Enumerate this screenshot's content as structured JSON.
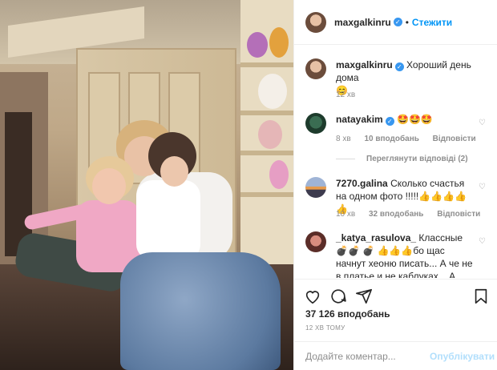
{
  "header": {
    "username": "maxgalkinru",
    "separator": "•",
    "follow_label": "Стежити"
  },
  "caption": {
    "username": "maxgalkinru",
    "text": "Хороший день дома",
    "emoji": "😊",
    "time": "12 хв"
  },
  "comments": [
    {
      "username": "natayakim",
      "verified": true,
      "text": "🤩🤩🤩",
      "time": "8 хв",
      "likes": "10 вподобань",
      "reply": "Відповісти",
      "view_replies": "Переглянути відповіді (2)"
    },
    {
      "username": "7270.galina",
      "verified": false,
      "text": "Сколько счастья на одном фото !!!!!👍👍👍👍👍",
      "time": "10 хв",
      "likes": "32 вподобань",
      "reply": "Відповісти"
    },
    {
      "username": "_katya_rasulova_",
      "verified": false,
      "text": "Классные 💣💣 💣 👍👍👍бо щас начнут хеоню писать... А че не в платье и не каблуках... А сами сидят по"
    }
  ],
  "post": {
    "likes_count": "37 126 вподобань",
    "timestamp": "12 ХВ ТОМУ"
  },
  "comment_box": {
    "placeholder": "Додайте коментар...",
    "post_label": "Опублікувати"
  },
  "icons": {
    "verified": "verified-badge-icon",
    "heart": "heart-icon",
    "comment": "comment-icon",
    "share": "share-icon",
    "save": "bookmark-icon"
  },
  "colors": {
    "link_blue": "#0095f6",
    "verified_blue": "#3897f0",
    "muted_text": "#8e8e8e",
    "post_disabled": "#b2dffc"
  }
}
